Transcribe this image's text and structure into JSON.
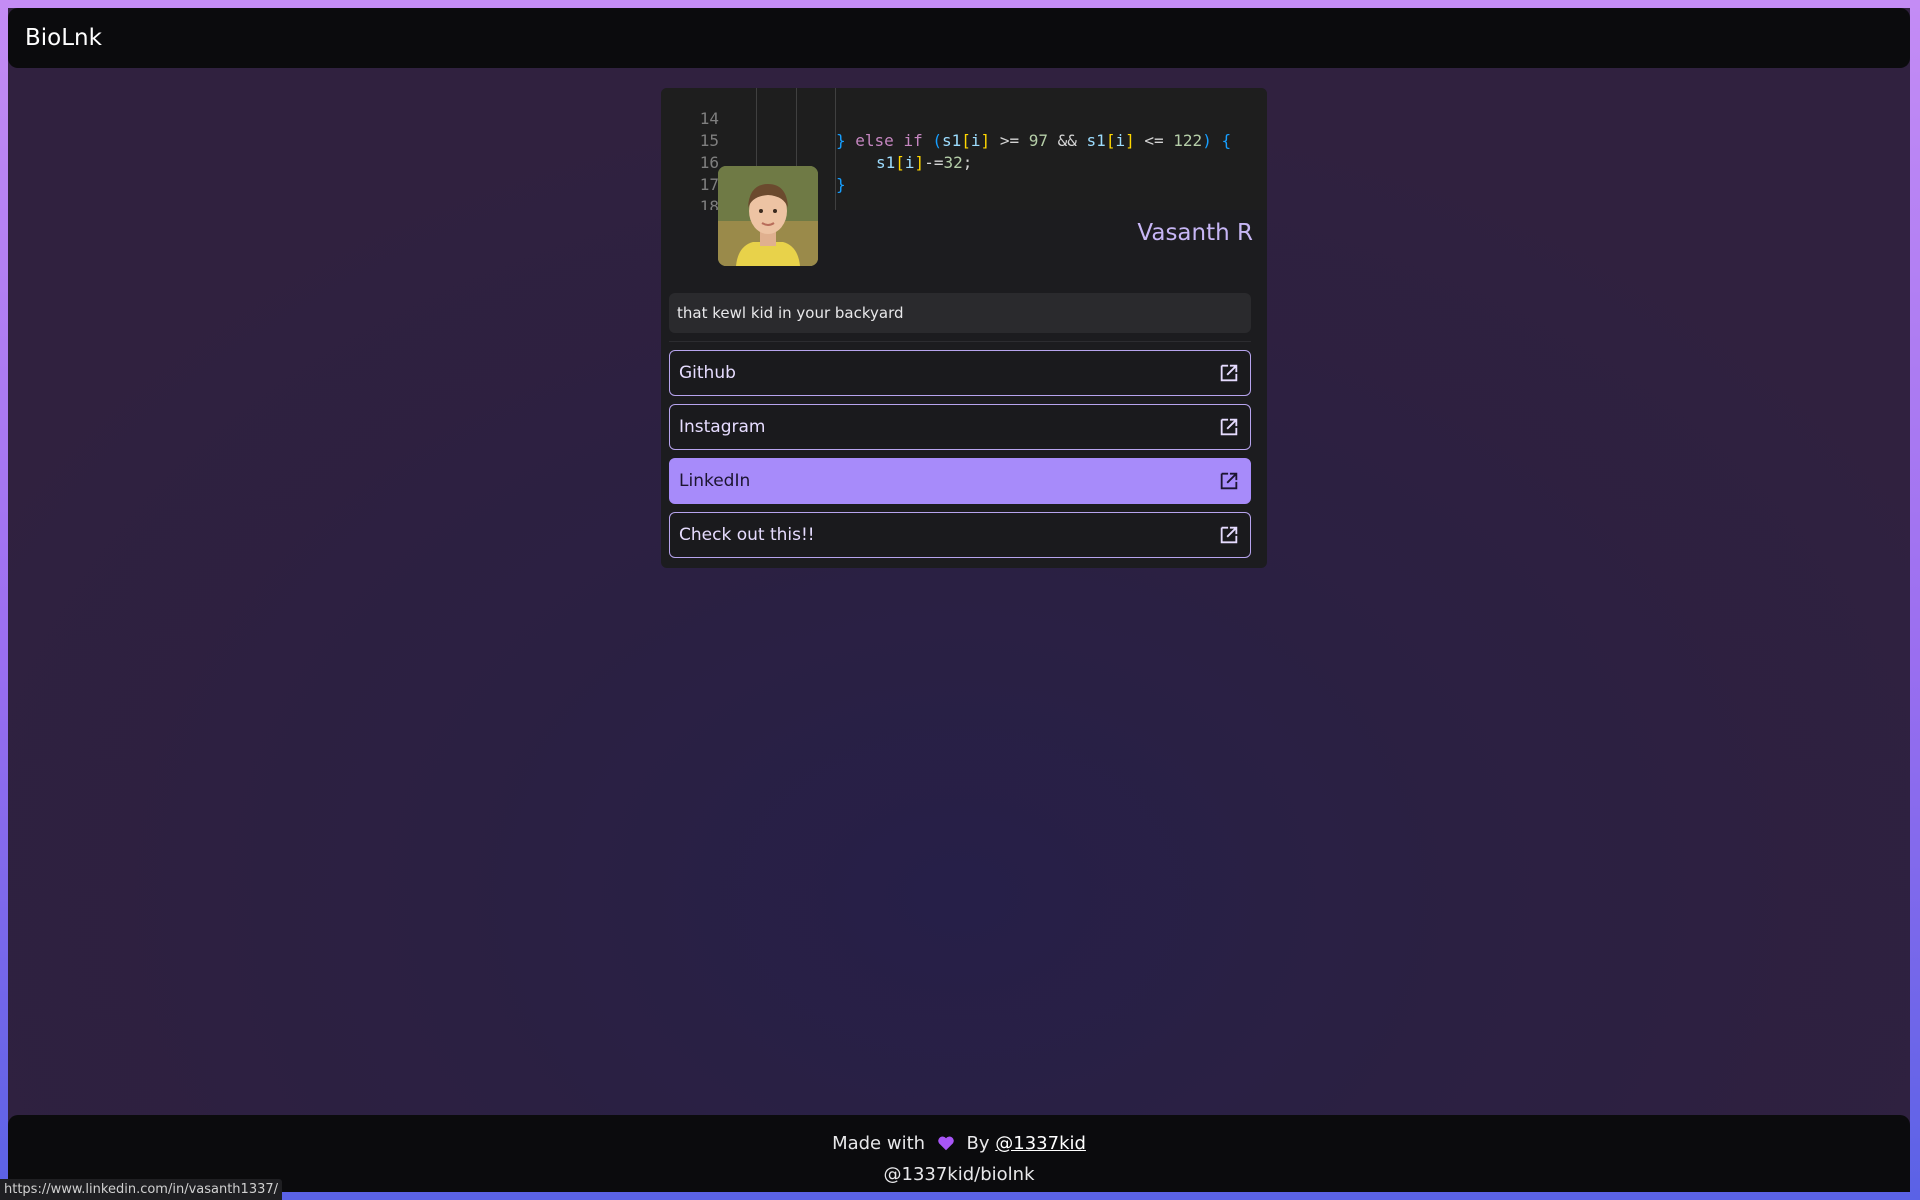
{
  "app": {
    "brand": "BioLnk"
  },
  "banner": {
    "lines": [
      {
        "num": "14"
      },
      {
        "num": "15"
      },
      {
        "num": "16"
      },
      {
        "num": "17"
      },
      {
        "num": "18"
      }
    ]
  },
  "profile": {
    "name": "Vasanth R",
    "bio": "that kewl kid in your backyard",
    "avatar_icon": "profile-photo"
  },
  "links": [
    {
      "label": "Github",
      "active": false
    },
    {
      "label": "Instagram",
      "active": false
    },
    {
      "label": "LinkedIn",
      "active": true
    },
    {
      "label": "Check out this!!",
      "active": false
    }
  ],
  "footer": {
    "made_prefix": "Made with",
    "by": "By",
    "author": "@1337kid",
    "repo": "@1337kid/biolnk"
  },
  "status": {
    "url": "https://www.linkedin.com/in/vasanth1337/"
  },
  "colors": {
    "accent": "#a78bfa",
    "heart": "#a855f7",
    "navbar": "#0b0b0d"
  }
}
